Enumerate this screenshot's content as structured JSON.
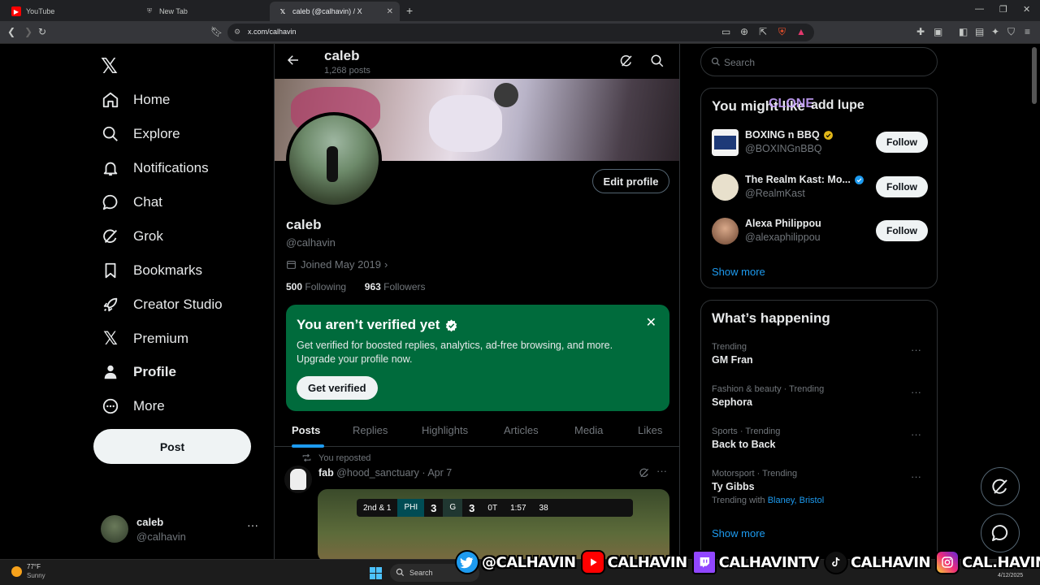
{
  "browser": {
    "tabs": [
      {
        "title": "YouTube"
      },
      {
        "title": "New Tab"
      },
      {
        "title": "caleb (@calhavin) / X"
      }
    ],
    "url": "x.com/calhavin"
  },
  "nav": {
    "items": [
      {
        "label": "Home",
        "icon": "home-icon"
      },
      {
        "label": "Explore",
        "icon": "search-icon"
      },
      {
        "label": "Notifications",
        "icon": "bell-icon"
      },
      {
        "label": "Chat",
        "icon": "chat-bubble-icon"
      },
      {
        "label": "Grok",
        "icon": "grok-icon"
      },
      {
        "label": "Bookmarks",
        "icon": "bookmark-icon"
      },
      {
        "label": "Creator Studio",
        "icon": "rocket-icon"
      },
      {
        "label": "Premium",
        "icon": "x-logo-icon"
      },
      {
        "label": "Profile",
        "icon": "person-icon"
      },
      {
        "label": "More",
        "icon": "more-circle-icon"
      }
    ],
    "post_label": "Post",
    "account": {
      "name": "caleb",
      "handle": "@calhavin"
    }
  },
  "profile": {
    "header_name": "caleb",
    "post_count": "1,268 posts",
    "edit_label": "Edit profile",
    "name": "caleb",
    "handle": "@calhavin",
    "joined": "Joined May 2019",
    "following_count": "500",
    "following_label": "Following",
    "followers_count": "963",
    "followers_label": "Followers"
  },
  "verify_card": {
    "title": "You aren’t verified yet",
    "description": "Get verified for boosted replies, analytics, ad-free browsing, and more. Upgrade your profile now.",
    "button": "Get verified"
  },
  "profile_tabs": [
    "Posts",
    "Replies",
    "Highlights",
    "Articles",
    "Media",
    "Likes"
  ],
  "post": {
    "repost_label": "You reposted",
    "author": "fab",
    "handle": "@hood_sanctuary",
    "date": "· Apr 7",
    "scorebug": {
      "down": "2nd & 1",
      "team1": "PHI",
      "score1": "3",
      "team2": "G",
      "score2": "3",
      "quarter": "0T",
      "clock": "1:57",
      "play": "38"
    }
  },
  "search": {
    "placeholder": "Search"
  },
  "who_to_follow": {
    "title": "You might like",
    "overlay_text": "CLONE",
    "overlay_text2": "add lupe",
    "accounts": [
      {
        "name": "BOXING n BBQ",
        "handle": "@BOXINGnBBQ",
        "badge": "gold",
        "follow": "Follow"
      },
      {
        "name": "The Realm Kast: Mo...",
        "handle": "@RealmKast",
        "badge": "blue",
        "follow": "Follow"
      },
      {
        "name": "Alexa Philippou",
        "handle": "@alexaphilippou",
        "badge": "",
        "follow": "Follow"
      }
    ],
    "show_more": "Show more"
  },
  "happening": {
    "title": "What’s happening",
    "trends": [
      {
        "context": "Trending",
        "title": "GM Fran"
      },
      {
        "context": "Fashion & beauty · Trending",
        "title": "Sephora"
      },
      {
        "context": "Sports · Trending",
        "title": "Back to Back"
      },
      {
        "context": "Motorsport · Trending",
        "title": "Ty Gibbs",
        "with_label": "Trending with",
        "with_links": "Blaney, Bristol"
      }
    ],
    "show_more": "Show more"
  },
  "taskbar": {
    "temp": "77°F",
    "weather": "Sunny",
    "search": "Search",
    "date": "4/12/2025"
  },
  "stream_overlay": [
    {
      "platform": "twitter",
      "text": "@CALHAVIN",
      "color": "#1d9bf0"
    },
    {
      "platform": "youtube",
      "text": "CALHAVIN",
      "color": "#ff0000"
    },
    {
      "platform": "twitch",
      "text": "CALHAVINTV",
      "color": "#9146ff"
    },
    {
      "platform": "tiktok",
      "text": "CALHAVIN",
      "color": "#111111"
    },
    {
      "platform": "instagram",
      "text": "CAL.HAVIN",
      "color": "#d6249f"
    }
  ],
  "colors": {
    "accent": "#1d9bf0",
    "verify_bg": "#006b3c",
    "background": "#000000"
  }
}
